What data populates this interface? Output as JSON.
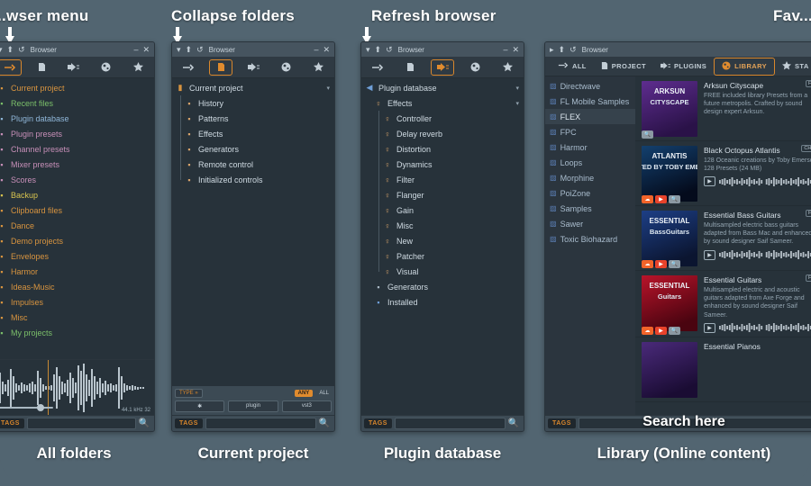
{
  "annotations": {
    "browser_menu": "...wser menu",
    "collapse_folders": "Collapse folders",
    "refresh_browser": "Refresh browser",
    "favorites": "Fav..."
  },
  "captions": {
    "p1": "All folders",
    "p2": "Current project",
    "p3": "Plugin database",
    "p4": "Library (Online content)"
  },
  "titlebar": {
    "title": "Browser",
    "minimize": "–",
    "close": "✕"
  },
  "panel1": {
    "toolbar": [
      "all-folders-icon",
      "current-project-icon",
      "plugin-database-icon",
      "plugin-presets-icon",
      "favorites-icon"
    ],
    "selected_tool": 0,
    "items": [
      {
        "label": "Current project",
        "color": "#d8943f"
      },
      {
        "label": "Recent files",
        "color": "#7bbf6a"
      },
      {
        "label": "Plugin database",
        "color": "#8fb6d8"
      },
      {
        "label": "Plugin presets",
        "color": "#c78fb8"
      },
      {
        "label": "Channel presets",
        "color": "#c78fb8"
      },
      {
        "label": "Mixer presets",
        "color": "#c78fb8"
      },
      {
        "label": "Scores",
        "color": "#c78fb8"
      },
      {
        "label": "Backup",
        "color": "#d8c44f"
      },
      {
        "label": "Clipboard files",
        "color": "#d8943f"
      },
      {
        "label": "Dance",
        "color": "#d8943f"
      },
      {
        "label": "Demo projects",
        "color": "#d8943f"
      },
      {
        "label": "Envelopes",
        "color": "#d8943f"
      },
      {
        "label": "Harmor",
        "color": "#d8943f"
      },
      {
        "label": "Ideas-Music",
        "color": "#d8943f"
      },
      {
        "label": "Impulses",
        "color": "#d8943f"
      },
      {
        "label": "Misc",
        "color": "#d8943f"
      },
      {
        "label": "My projects",
        "color": "#7bbf6a"
      }
    ],
    "waveform_info": "44.1 kHz 32",
    "tags_label": "TAGS"
  },
  "panel2": {
    "selected_tool": 1,
    "root": "Current project",
    "items": [
      {
        "label": "History",
        "icon": "history-icon"
      },
      {
        "label": "Patterns",
        "icon": "note-icon"
      },
      {
        "label": "Effects",
        "icon": "effect-icon"
      },
      {
        "label": "Generators",
        "icon": "keyboard-icon"
      },
      {
        "label": "Remote control",
        "icon": "remote-icon"
      },
      {
        "label": "Initialized controls",
        "icon": "controls-icon"
      }
    ],
    "filters": {
      "type_label": "TYPE »",
      "any_label": "ANY",
      "all_label": "ALL",
      "chips": [
        "✱",
        "plugin",
        "vst3"
      ]
    },
    "tags_label": "TAGS"
  },
  "panel3": {
    "selected_tool": 2,
    "root": "Plugin database",
    "group": "Effects",
    "items": [
      "Controller",
      "Delay reverb",
      "Distortion",
      "Dynamics",
      "Filter",
      "Flanger",
      "Gain",
      "Misc",
      "New",
      "Patcher",
      "Visual"
    ],
    "footer_items": [
      {
        "label": "Generators",
        "icon": "keyboard-icon"
      },
      {
        "label": "Installed",
        "icon": "plug-icon"
      }
    ],
    "tags_label": "TAGS"
  },
  "panel4": {
    "tabs": [
      {
        "label": "ALL",
        "icon": "all-folders-icon",
        "selected": false
      },
      {
        "label": "PROJECT",
        "icon": "current-project-icon",
        "selected": false
      },
      {
        "label": "PLUGINS",
        "icon": "plug-icon",
        "selected": false
      },
      {
        "label": "LIBRARY",
        "icon": "library-icon",
        "selected": true
      },
      {
        "label": "STA",
        "icon": "star-icon",
        "selected": false
      }
    ],
    "folders": [
      {
        "label": "Directwave",
        "selected": false
      },
      {
        "label": "FL Mobile Samples",
        "selected": false
      },
      {
        "label": "FLEX",
        "selected": true
      },
      {
        "label": "FPC",
        "selected": false
      },
      {
        "label": "Harmor",
        "selected": false
      },
      {
        "label": "Loops",
        "selected": false
      },
      {
        "label": "Morphine",
        "selected": false
      },
      {
        "label": "PoiZone",
        "selected": false
      },
      {
        "label": "Samples",
        "selected": false
      },
      {
        "label": "Sawer",
        "selected": false
      },
      {
        "label": "Toxic Biohazard",
        "selected": false
      }
    ],
    "items": [
      {
        "title": "Arksun Cityscape",
        "desc": "FREE included library Presets from a future metropolis. Crafted by sound design expert Arksun.",
        "thumb_text_1": "ARKSUN",
        "thumb_text_2": "CITYSCAPE",
        "thumb_color_a": "#5e2d8f",
        "thumb_color_b": "#2a1248",
        "badges": [
          "gl"
        ],
        "free_tag": "FRE",
        "has_player": false
      },
      {
        "title": "Black Octopus Atlantis",
        "desc": "128 Oceanic creations by Toby Emerson 128 Presets (24 MB)",
        "thumb_text_1": "ATLANTIS",
        "thumb_text_2": "CREATED BY TOBY EMERSON",
        "thumb_color_a": "#13406e",
        "thumb_color_b": "#040b1c",
        "badges": [
          "sc",
          "yt",
          "gl"
        ],
        "free_tag": "CHAN",
        "has_player": true
      },
      {
        "title": "Essential Bass Guitars",
        "desc": "Multisampled electric bass guitars adapted from Bass Mac and enhanced by sound designer Saif Sameer.",
        "thumb_text_1": "ESSENTIAL",
        "thumb_text_2": "BassGuitars",
        "thumb_color_a": "#1d3f86",
        "thumb_color_b": "#0b1530",
        "badges": [
          "sc",
          "yt",
          "gl"
        ],
        "free_tag": "FRE",
        "has_player": true
      },
      {
        "title": "Essential Guitars",
        "desc": "Multisampled electric and acoustic guitars adapted from Axe Forge and enhanced by sound designer Saif Sameer.",
        "thumb_text_1": "ESSENTIAL",
        "thumb_text_2": "Guitars",
        "thumb_color_a": "#b8142a",
        "thumb_color_b": "#4a0410",
        "badges": [
          "sc",
          "yt",
          "gl"
        ],
        "free_tag": "FRE",
        "has_player": true
      },
      {
        "title": "Essential Pianos",
        "desc": "",
        "thumb_text_1": "",
        "thumb_text_2": "",
        "thumb_color_a": "#4a2a7a",
        "thumb_color_b": "#1a0c33",
        "badges": [],
        "free_tag": "",
        "has_player": false
      }
    ],
    "tags_label": "TAGS",
    "search_here": "Search here"
  }
}
